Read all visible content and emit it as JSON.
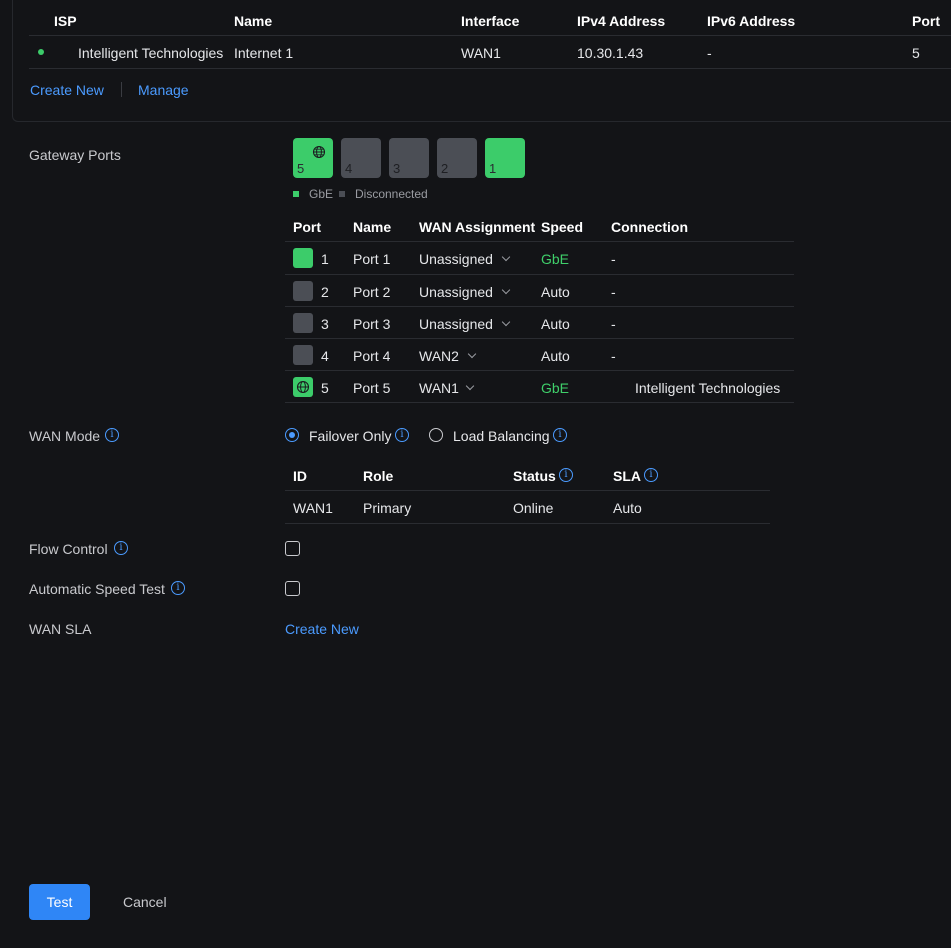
{
  "isp_table": {
    "headers": {
      "isp": "ISP",
      "name": "Name",
      "interface": "Interface",
      "ipv4": "IPv4 Address",
      "ipv6": "IPv6 Address",
      "port": "Port"
    },
    "rows": [
      {
        "isp": "Intelligent Technologies",
        "name": "Internet 1",
        "interface": "WAN1",
        "ipv4": "10.30.1.43",
        "ipv6": "-",
        "port": "5"
      }
    ],
    "create_new": "Create New",
    "manage": "Manage"
  },
  "gateway_ports": {
    "label": "Gateway Ports",
    "ports": [
      {
        "number": "5",
        "state": "active",
        "globe": true
      },
      {
        "number": "4",
        "state": "disconnected"
      },
      {
        "number": "3",
        "state": "disconnected"
      },
      {
        "number": "2",
        "state": "disconnected"
      },
      {
        "number": "1",
        "state": "active"
      }
    ],
    "legend": {
      "active": "GbE",
      "inactive": "Disconnected"
    }
  },
  "port_table": {
    "headers": {
      "port": "Port",
      "name": "Name",
      "wan": "WAN Assignment",
      "speed": "Speed",
      "connection": "Connection"
    },
    "rows": [
      {
        "port": "1",
        "name": "Port 1",
        "wan": "Unassigned",
        "speed": "GbE",
        "connection": "-"
      },
      {
        "port": "2",
        "name": "Port 2",
        "wan": "Unassigned",
        "speed": "Auto",
        "connection": "-"
      },
      {
        "port": "3",
        "name": "Port 3",
        "wan": "Unassigned",
        "speed": "Auto",
        "connection": "-"
      },
      {
        "port": "4",
        "name": "Port 4",
        "wan": "WAN2",
        "speed": "Auto",
        "connection": "-"
      },
      {
        "port": "5",
        "name": "Port 5",
        "wan": "WAN1",
        "speed": "GbE",
        "connection": "Intelligent Technologies"
      }
    ]
  },
  "wan_mode": {
    "label": "WAN Mode",
    "options": {
      "failover": "Failover Only",
      "load_balancing": "Load Balancing"
    },
    "selected": "Failover Only"
  },
  "wan_table": {
    "headers": {
      "id": "ID",
      "role": "Role",
      "status": "Status",
      "sla": "SLA"
    },
    "rows": [
      {
        "id": "WAN1",
        "role": "Primary",
        "status": "Online",
        "sla": "Auto"
      }
    ]
  },
  "flow_control": {
    "label": "Flow Control",
    "checked": false
  },
  "speed_test": {
    "label": "Automatic Speed Test",
    "checked": false
  },
  "wan_sla": {
    "label": "WAN SLA",
    "action": "Create New"
  },
  "footer": {
    "test": "Test",
    "cancel": "Cancel"
  },
  "colors": {
    "background": "#131417",
    "accent": "#2f86f6",
    "link": "#4b9bff",
    "active": "#3ccc6a",
    "inactive": "#4b4e55"
  }
}
